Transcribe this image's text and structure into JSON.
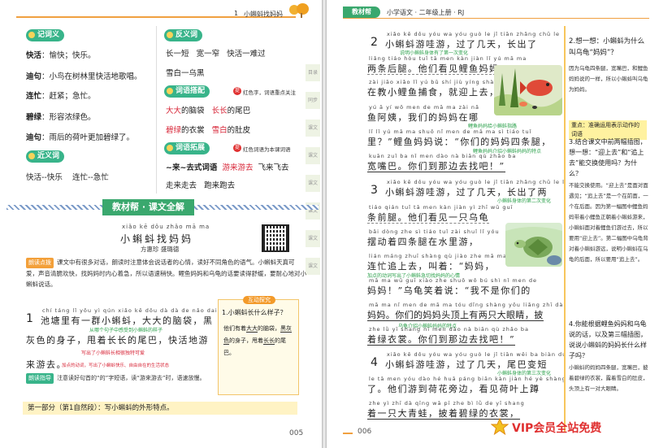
{
  "left": {
    "header": {
      "num": "1",
      "title": "小蝌蚪找妈妈"
    },
    "sections": {
      "ji_yi_ci": "记词义",
      "fan_yi_ci": "反义词",
      "ci_yu_da_pei": "词语搭配",
      "ci_yu_tuo_zhan": "词语拓展",
      "jin_yi_ci": "近义词"
    },
    "defs": [
      {
        "word": "快活",
        "def": "：愉快；快乐。"
      },
      {
        "word": "迪句",
        "def": "：小鸟在树林里快活地歌唱。"
      },
      {
        "word": "连忙",
        "def": "：赶紧；急忙。"
      },
      {
        "word": "碧绿",
        "def": "：形容浓绿色。"
      },
      {
        "word": "迪句",
        "def": "：雨后的荷叶更加碧绿了。"
      }
    ],
    "antonyms": [
      "长一短",
      "宽一窄",
      "快活一难过",
      "雪白一乌黑"
    ],
    "collocation_note": "红色字，词语重点关注",
    "collocations": [
      [
        "大大",
        "的脑袋"
      ],
      [
        "长长",
        "的尾巴"
      ],
      [
        "碧绿",
        "的衣裳"
      ],
      [
        "雪白",
        "的肚皮"
      ]
    ],
    "expansion_note": "红色词语为本课词语",
    "expansion": [
      "~来~去式词语",
      "游来游去",
      "飞来飞去",
      "走来走去",
      "跑来跑去"
    ],
    "synonyms": [
      "快活--快乐",
      "连忙--急忙"
    ],
    "side_tabs": [
      "目录",
      "同步",
      "课文",
      "课文",
      "课文",
      "课文",
      "课文",
      "课文"
    ],
    "banner": "教材帮 · 课文全解",
    "lesson": {
      "pinyin": "xiǎo kē dǒu zhǎo mā ma",
      "title": "小蝌蚪找妈妈",
      "authors": "方惠珍  盛璐德"
    },
    "guide_tag": "朗读点拨",
    "guide_text": "课文中有很多对话，朗读时注意体会说话者的心情，读好不同角色的语气。小蝌蚪天真可爱，声音清脆欢快，找妈妈时内心着急，所以语速稍快。鲤鱼妈妈和乌龟的话要读得舒缓，要耐心地对小蝌蚪说话。",
    "p1": {
      "num": "1",
      "pinyin": "chí táng lǐ yǒu yì qún xiǎo kē dǒu  dà dà de nǎo dai  hēi",
      "l1": "池塘里有一群小蝌蚪，大大的脑袋，黑",
      "n1": "从哪个句子中感受到小蝌蚪的样子",
      "l2": "灰色的身子，甩着长长的尾巴，快活地游",
      "n2": "写出了小蝌蚪长相很独特可爱",
      "l3": "来游去。",
      "n3": "加点的动词，写出了小蝌蚪快乐、自由自在的生活状态",
      "read_tag": "朗读指导",
      "read": "注意读好句首的“的”字短语，读“游来游去”时，语速放慢。"
    },
    "qbox": {
      "head": "互动探究",
      "q": "1.小蝌蚪长什么样子？",
      "a1": "他们有着",
      "a2": "大大",
      "a3": "的脑袋，",
      "a4": "黑灰色",
      "a5": "的身子，甩着",
      "a6": "长长",
      "a7": "的尾巴。"
    },
    "part": "第一部分（第1自然段）：写小蝌蚪的外形特点。",
    "page": "005"
  },
  "right": {
    "header": {
      "tag": "教材帮",
      "title": "小学语文 · 二年级上册 · RJ"
    },
    "paras": [
      {
        "num": "2",
        "lines": [
          "小蝌蚪游哇游，过了几天，长出了",
          "两条后腿。他们看见鲤鱼妈妈",
          "在教小鲤鱼捕食，就迎上去，问：“鲤",
          "鱼阿姨，我们的妈妈在哪",
          "里？”鲤鱼妈妈说：“你们的妈妈四条腿，",
          "宽嘴巴。你们到那边去找吧！”"
        ]
      },
      {
        "num": "3",
        "lines": [
          "小蝌蚪游哇游，过了几天，长出了两",
          "条前腿。他们看见一只乌龟",
          "摆动着四条腿在水里游，",
          "连忙追上去，叫着：“妈妈，",
          "妈妈！”乌龟笑着说：“我不是你们的",
          "妈妈。你们的妈妈头顶上有两只大眼睛，披",
          "着绿衣裳。你们到那边去找吧！”"
        ]
      },
      {
        "num": "4",
        "lines": [
          "小蝌蚪游哇游，过了几天，尾巴变短",
          "了。他们游到荷花旁边，看见荷叶上蹲",
          "着一只大青蛙，披着碧绿的衣裳，"
        ]
      }
    ],
    "pinyin_rows": [
      "xiǎo kē dǒu yóu wa yóu  guò le jǐ tiān  zhǎng chū le",
      "liǎng tiáo hòu tuǐ  tā men kàn jiàn lǐ yú mā ma",
      "zài jiāo xiǎo lǐ yú bǔ shí  jiù yíng shàng qù wèn",
      "yú ā yí  wǒ men de mā ma zài nǎ",
      "lǐ   lǐ yú mā ma shuō  nǐ men de mā ma sì tiáo tuǐ",
      "kuān zuǐ ba  nǐ men dào nà biān qù zhǎo ba",
      "xiǎo kē dǒu yóu wa yóu  guò le jǐ tiān  zhǎng chū le liǎng",
      "tiáo qián tuǐ  tā men kàn jiàn yì zhī wū guī",
      "bǎi dòng zhe sì tiáo tuǐ zài shuǐ lǐ yóu",
      "lián máng zhuī shàng qù  jiào zhe  mā ma",
      "mā ma  wū guī xiào zhe shuō  wǒ bú shì nǐ men de",
      "mā ma  nǐ men de mā ma tóu dǐng shàng yǒu liǎng zhī dà yǎn jing  pī",
      "zhe lǜ yī shang  nǐ men dào nà biān qù zhǎo ba",
      "xiǎo kē dǒu yóu wa yóu  guò le jǐ tiān  wěi ba biàn duǎn",
      "le  tā men yóu dào hé huā páng biān  kàn jiàn hé yè shàng dūn",
      "zhe yì zhī dà qīng wā  pī zhe bì lǜ de yī shang"
    ],
    "notes": [
      "说明小蝌蚪身体有了第一次变化",
      "鲤鱼妈妈给小蝌蚪指路",
      "鲤鱼妈妈介绍小蝌蚪妈妈的特点",
      "小蝌蚪身体的第二次变化",
      "加点的动词写出了小蝌蚪急切找妈妈的心情",
      "乌龟介绍小蝌蚪妈妈的特点",
      "小蝌蚪身体的第三次变化"
    ],
    "side": {
      "q2": "2.想一想：小蝌蚪为什么叫乌龟“妈妈”？",
      "a2": "因为乌龟四条腿，宽嘴巴，和鲤鱼妈妈说的一样，所以小蝌蚪叫乌龟为妈妈。",
      "key": "重点：准确运用表示动作的词语",
      "q3": "3.结合课文中前两幅插图，想一想：“迎上去”和“追上去”能交换使用吗？为什么？",
      "a3": "不能交换使用。“迎上去”是面对面遇见；“追上去”是一个在前面，一个在后面。因为第一幅图中鲤鱼妈妈带着小鲤鱼正朝着小蝌蚪游来，小蝌蚪面对着鲤鱼们游过去，所以要用“迎上去”。第二幅图中乌龟背对着小蝌蚪游远，说明小蝌蚪在乌龟的后面，所以要用“追上去”。",
      "q4": "4.你能根据鲤鱼妈妈和乌龟说的话，以及第三幅插图，说说小蝌蚪的妈妈长什么样子吗？",
      "a4": "小蝌蚪的妈妈四条腿，宽嘴巴，披着碧绿的衣裳，露着雪白的肚皮，头顶上有一对大眼睛。"
    },
    "page": "006",
    "watermark": "VIP会员全站免费"
  },
  "colors": {
    "green": "#38b48a",
    "orange": "#f3a03a",
    "red": "#d8283a"
  }
}
